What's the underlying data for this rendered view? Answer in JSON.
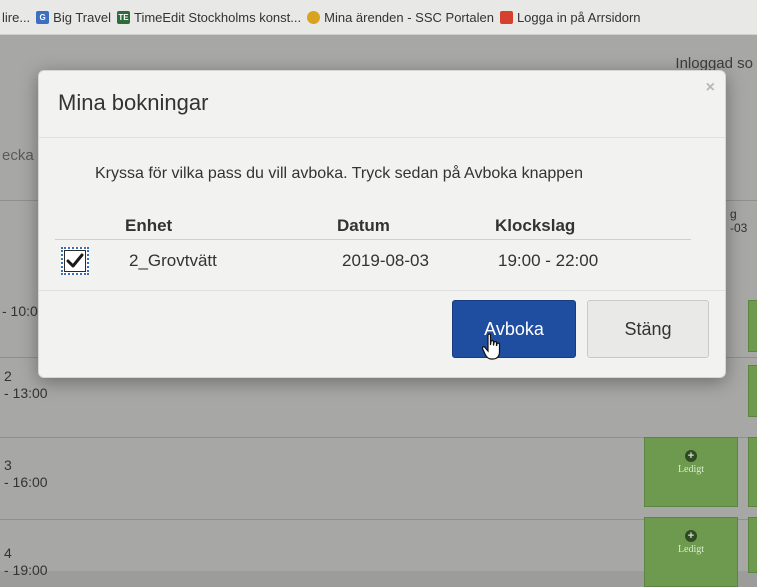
{
  "bookmarks": [
    {
      "label": "lire...",
      "icon": "",
      "icon_color": ""
    },
    {
      "label": "Big Travel",
      "icon": "G",
      "icon_color": "#3b6fc0"
    },
    {
      "label": "TimeEdit Stockholms konst...",
      "icon": "TE",
      "icon_color": "#2e6b3a"
    },
    {
      "label": "Mina ärenden - SSC Portalen",
      "icon": "",
      "icon_color": "#d9a321"
    },
    {
      "label": "Logga in på Arrsidorn",
      "icon": "",
      "icon_color": "#d6412d"
    }
  ],
  "background": {
    "user_label": "Inloggad so",
    "left_fragment": "ecka",
    "right_fragment_top": "g",
    "right_fragment_bottom": "-03",
    "rows": [
      {
        "num": "",
        "time": "- 10:0"
      },
      {
        "num": "2",
        "time": "- 13:00"
      },
      {
        "num": "3",
        "time": "- 16:00"
      },
      {
        "num": "4",
        "time": "- 19:00"
      }
    ],
    "slot_label": "Ledigt"
  },
  "modal": {
    "title": "Mina bokningar",
    "close_label": "×",
    "instruction": "Kryssa för vilka pass du vill avboka. Tryck sedan på Avboka knappen",
    "columns": [
      "Enhet",
      "Datum",
      "Klockslag"
    ],
    "rows": [
      {
        "checked": true,
        "enhet": "2_Grovtvätt",
        "datum": "2019-08-03",
        "klockslag": "19:00 - 22:00"
      }
    ],
    "buttons": {
      "avboka": "Avboka",
      "stang": "Stäng"
    }
  },
  "colors": {
    "primary": "#1f4ea1",
    "slot_green": "#6e9a4f"
  }
}
